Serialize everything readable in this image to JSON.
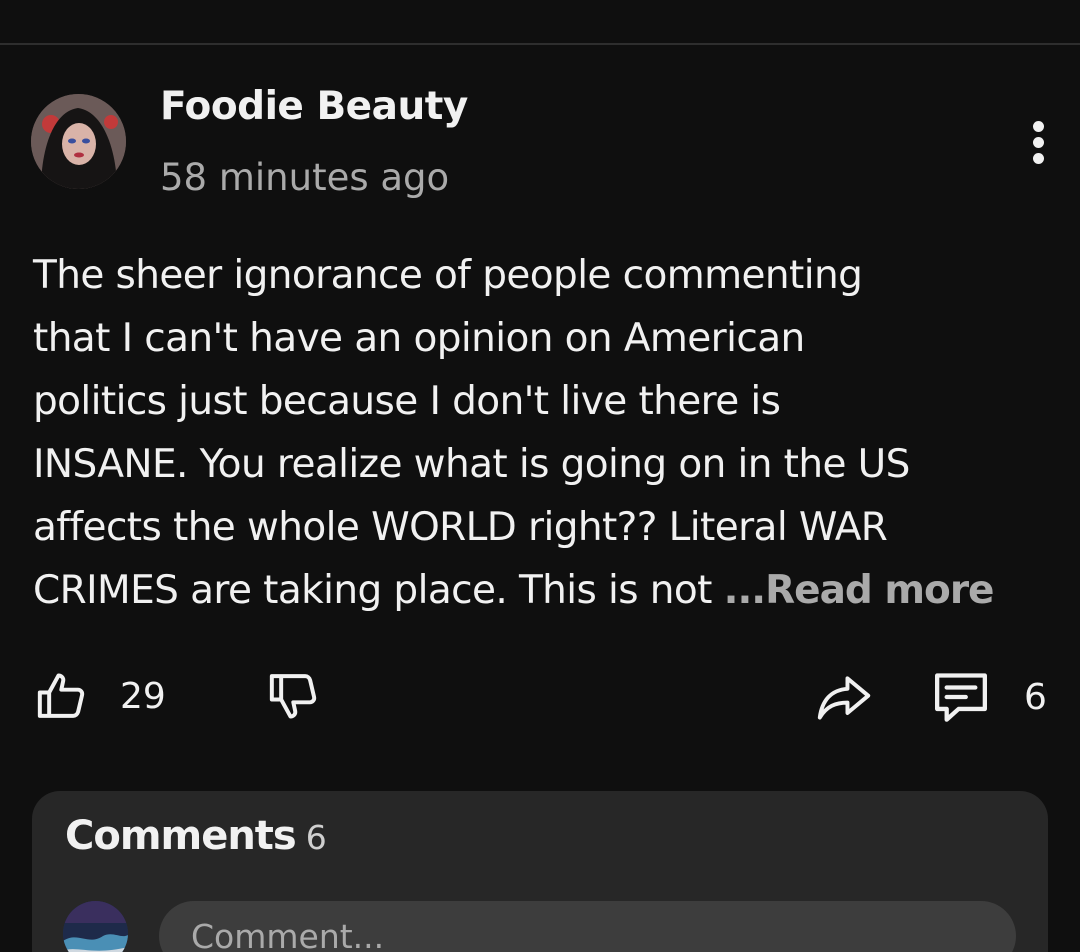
{
  "post": {
    "author": "Foodie Beauty",
    "timestamp": "58 minutes ago",
    "text_lines": [
      "The sheer ignorance of people commenting",
      "that I can't have an opinion on American",
      "politics just because I don't live there is",
      "INSANE. You realize what is going on in the US",
      "affects the whole WORLD right?? Literal WAR",
      "CRIMES are taking place. This is not "
    ],
    "read_more": "...Read more",
    "like_count": "29",
    "comment_count": "6"
  },
  "comments": {
    "title": "Comments",
    "count": "6",
    "input_placeholder": "Comment..."
  },
  "icons": {
    "menu": "more-vert-icon",
    "like": "thumb-up-icon",
    "dislike": "thumb-down-icon",
    "share": "share-arrow-icon",
    "comments": "comment-icon"
  },
  "colors": {
    "background": "#0f0f0f",
    "panel": "#272727",
    "secondary_text": "#aaaaaa"
  }
}
